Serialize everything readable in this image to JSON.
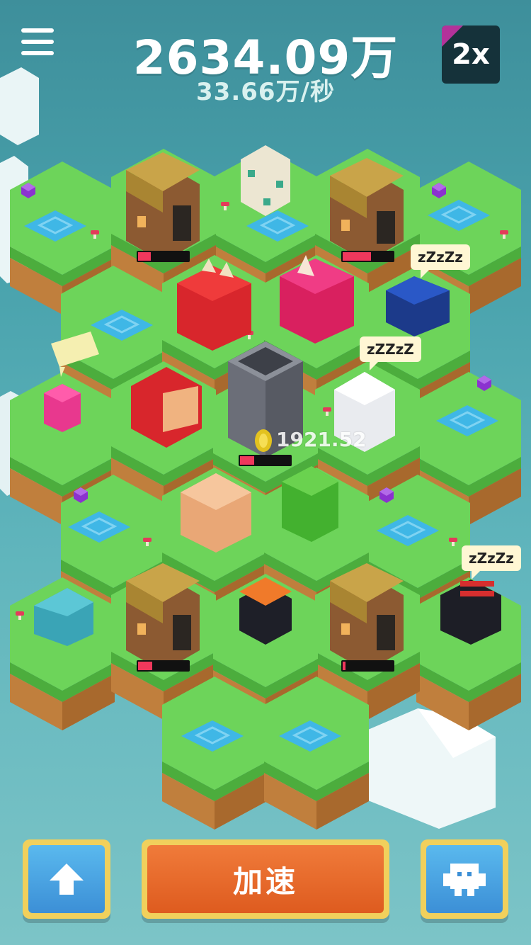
{
  "hud": {
    "score": "2634.09万",
    "rate": "33.66万/秒",
    "speed_multiplier": "2x",
    "menu_icon": "hamburger-menu-icon"
  },
  "floating": {
    "coin_amount": "1921.52"
  },
  "sleep_bubbles": [
    "zZzZz",
    "zZZzZ",
    "zZzZz"
  ],
  "buttons": {
    "upgrade_icon": "arrow-up-icon",
    "boost_label": "加速",
    "monster_icon": "monster-face-icon"
  },
  "huts": [
    {
      "name": "hut-top-left",
      "progress": 0.25
    },
    {
      "name": "hut-top-right",
      "progress": 0.55
    },
    {
      "name": "hut-middle",
      "progress": 0.3
    },
    {
      "name": "hut-bottom-left",
      "progress": 0.3
    },
    {
      "name": "hut-bottom-right",
      "progress": 0.06
    }
  ],
  "colors": {
    "background": "#4aa3ad",
    "grass": "#6dd45a",
    "soil": "#c98b45",
    "water": "#3fb7e6",
    "boost_button": "#e0652a",
    "side_button": "#4aa6e2",
    "button_frame": "#f1d05c",
    "progress_fill": "#f0385c"
  }
}
